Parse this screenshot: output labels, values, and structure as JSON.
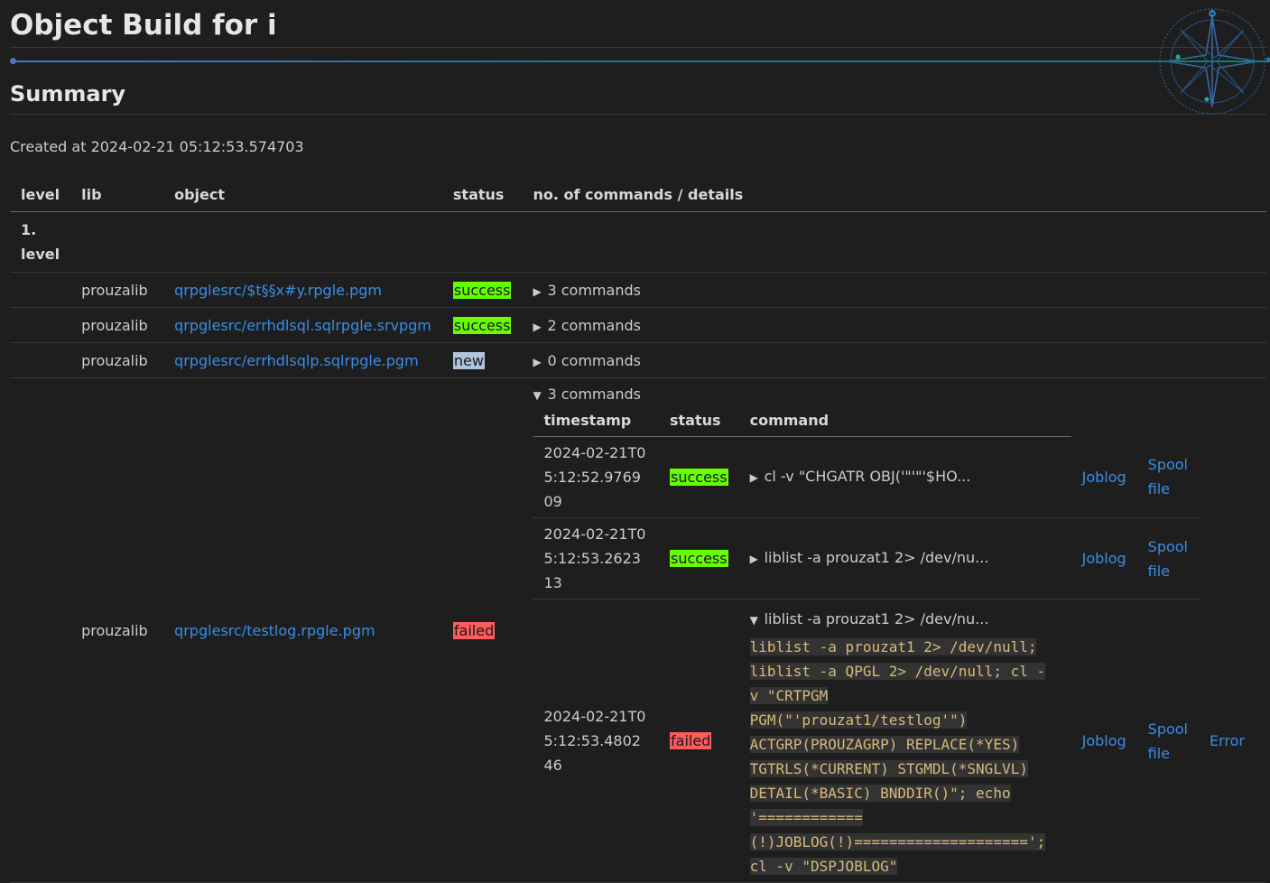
{
  "header": {
    "title": "Object Build for i"
  },
  "summary": {
    "heading": "Summary",
    "created_label": "Created at 2024-02-21 05:12:53.574703"
  },
  "table": {
    "columns": [
      "level",
      "lib",
      "object",
      "status",
      "no. of commands / details"
    ],
    "level_label": "1. level",
    "rows": [
      {
        "lib": "prouzalib",
        "object": "qrpglesrc/$t§§x#y.rpgle.pgm",
        "status": "success",
        "commands": "3 commands"
      },
      {
        "lib": "prouzalib",
        "object": "qrpglesrc/errhdlsql.sqlrpgle.srvpgm",
        "status": "success",
        "commands": "2 commands"
      },
      {
        "lib": "prouzalib",
        "object": "qrpglesrc/errhdlsqlp.sqlrpgle.pgm",
        "status": "new",
        "commands": "0 commands"
      },
      {
        "lib": "prouzalib",
        "object": "qrpglesrc/testlog.rpgle.pgm",
        "status": "failed",
        "commands": "3 commands"
      }
    ]
  },
  "inner": {
    "columns": [
      "timestamp",
      "status",
      "command"
    ],
    "rows": [
      {
        "timestamp": "2024-02-21T05:12:52.976909",
        "status": "success",
        "command": "cl -v \"CHGATR OBJ('\"'\"'$HO...",
        "joblog": "Joblog",
        "spool": "Spool file"
      },
      {
        "timestamp": "2024-02-21T05:12:53.262313",
        "status": "success",
        "command": "liblist -a prouzat1 2> /dev/nu...",
        "joblog": "Joblog",
        "spool": "Spool file"
      },
      {
        "timestamp": "2024-02-21T05:12:53.480246",
        "status": "failed",
        "command": "liblist -a prouzat1 2> /dev/nu...",
        "joblog": "Joblog",
        "spool": "Spool file",
        "error": "Error",
        "full_command": [
          "liblist -a prouzat1 2> /dev/null;",
          "liblist -a QPGL 2> /dev/null; cl -",
          "v \"CRTPGM",
          "PGM(\"'prouzat1/testlog'\")",
          "ACTGRP(PROUZAGRP) REPLACE(*YES)",
          "TGTRLS(*CURRENT) STGMDL(*SNGLVL)",
          "DETAIL(*BASIC) BNDDIR()\"; echo",
          "'============",
          "(!)JOBLOG(!)====================';",
          "cl -v \"DSPJOBLOG\""
        ]
      }
    ]
  },
  "colors": {
    "background": "#1e1e1e",
    "link": "#3a8ee6",
    "success": "#66ff00",
    "failed": "#ff5c5c",
    "new": "#b0c4de"
  }
}
